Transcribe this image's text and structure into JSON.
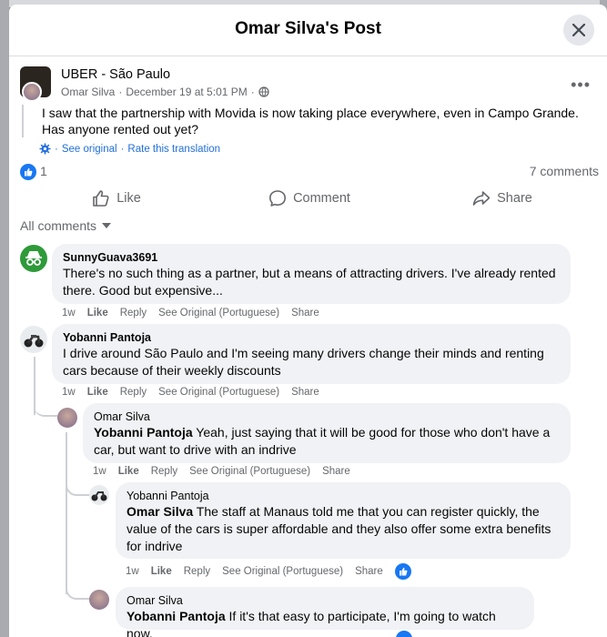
{
  "modal": {
    "title": "Omar Silva's Post"
  },
  "post": {
    "group": "UBER - São Paulo",
    "author": "Omar Silva",
    "date": "December 19 at 5:01 PM",
    "body": "I saw that the partnership with Movida is now taking place everywhere, even in Campo Grande. Has anyone rented out yet?",
    "see_original": "See original",
    "rate_translation": "Rate this translation",
    "like_count": "1",
    "comment_count": "7 comments"
  },
  "actions": {
    "like": "Like",
    "comment": "Comment",
    "share": "Share"
  },
  "filter": {
    "label": "All comments"
  },
  "comments": [
    {
      "author": "SunnyGuava3691",
      "text": "There's no such thing as a partner, but a means of attracting drivers. I've already rented there. Good but expensive...",
      "time": "1w",
      "like": "Like",
      "reply": "Reply",
      "see_original": "See Original (Portuguese)",
      "share": "Share"
    },
    {
      "author": "Yobanni Pantoja",
      "text": "I drive around São Paulo and I'm seeing many drivers change their minds and renting cars because of their weekly discounts",
      "time": "1w",
      "like": "Like",
      "reply": "Reply",
      "see_original": "See Original (Portuguese)",
      "share": "Share"
    },
    {
      "author": "Omar Silva",
      "mention": "Yobanni Pantoja",
      "text": "Yeah, just saying that it will be good for those who don't have a car, but want to drive with an indrive",
      "time": "1w",
      "like": "Like",
      "reply": "Reply",
      "see_original": "See Original (Portuguese)",
      "share": "Share"
    },
    {
      "author": "Yobanni Pantoja",
      "mention": "Omar Silva",
      "text": "The staff at Manaus told me that you can register quickly, the value of the cars is super affordable and they also offer some extra benefits for indrive",
      "time": "1w",
      "like": "Like",
      "reply": "Reply",
      "see_original": "See Original (Portuguese)",
      "share": "Share"
    },
    {
      "author": "Omar Silva",
      "mention": "Yobanni Pantoja",
      "text": "If it's that easy to participate, I'm going to watch now."
    }
  ]
}
